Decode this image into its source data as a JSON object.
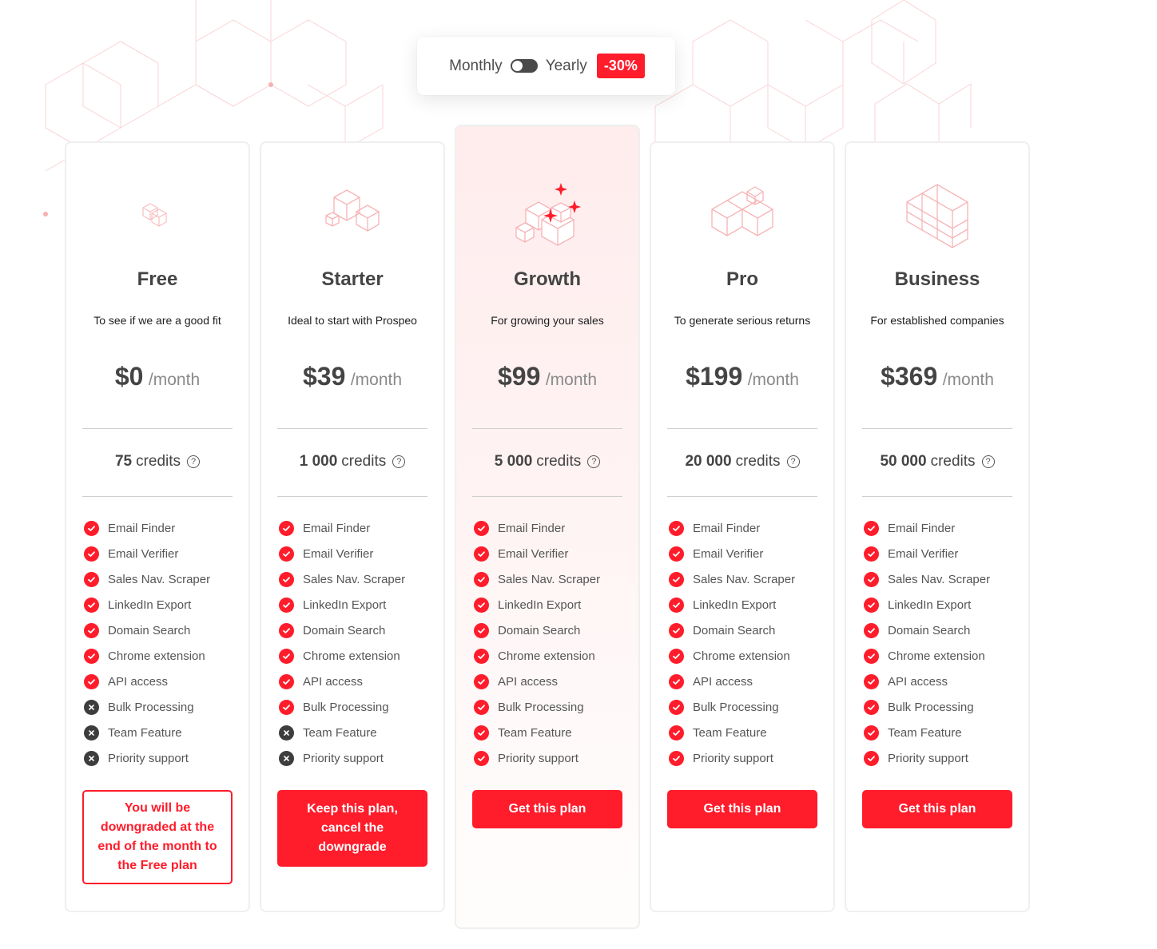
{
  "billing_toggle": {
    "monthly_label": "Monthly",
    "yearly_label": "Yearly",
    "selected": "Monthly",
    "discount_badge": "-30%"
  },
  "colors": {
    "accent": "#ff1c2b",
    "text_dark": "#444444",
    "icon_pink": "#f8b9bb",
    "disabled_icon": "#3d3d3d"
  },
  "plans": [
    {
      "id": "free",
      "name": "Free",
      "tagline": "To see if we are a good fit",
      "price": "$0",
      "period": "/month",
      "credits_amount": "75",
      "credits_label": "credits",
      "icon": "two-cubes-icon",
      "highlighted": false,
      "features": [
        {
          "label": "Email Finder",
          "included": true
        },
        {
          "label": "Email Verifier",
          "included": true
        },
        {
          "label": "Sales Nav. Scraper",
          "included": true
        },
        {
          "label": "LinkedIn Export",
          "included": true
        },
        {
          "label": "Domain Search",
          "included": true
        },
        {
          "label": "Chrome extension",
          "included": true
        },
        {
          "label": "API access",
          "included": true
        },
        {
          "label": "Bulk Processing",
          "included": false
        },
        {
          "label": "Team Feature",
          "included": false
        },
        {
          "label": "Priority support",
          "included": false
        }
      ],
      "cta": {
        "label": "You will be downgraded at the end of the month to the Free plan",
        "style": "outline"
      }
    },
    {
      "id": "starter",
      "name": "Starter",
      "tagline": "Ideal to start with Prospeo",
      "price": "$39",
      "period": "/month",
      "credits_amount": "1 000",
      "credits_label": "credits",
      "icon": "three-cubes-icon",
      "highlighted": false,
      "features": [
        {
          "label": "Email Finder",
          "included": true
        },
        {
          "label": "Email Verifier",
          "included": true
        },
        {
          "label": "Sales Nav. Scraper",
          "included": true
        },
        {
          "label": "LinkedIn Export",
          "included": true
        },
        {
          "label": "Domain Search",
          "included": true
        },
        {
          "label": "Chrome extension",
          "included": true
        },
        {
          "label": "API access",
          "included": true
        },
        {
          "label": "Bulk Processing",
          "included": true
        },
        {
          "label": "Team Feature",
          "included": false
        },
        {
          "label": "Priority support",
          "included": false
        }
      ],
      "cta": {
        "label": "Keep this plan, cancel the downgrade",
        "style": "solid"
      }
    },
    {
      "id": "growth",
      "name": "Growth",
      "tagline": "For growing your sales",
      "price": "$99",
      "period": "/month",
      "credits_amount": "5 000",
      "credits_label": "credits",
      "icon": "sparkle-cubes-icon",
      "highlighted": true,
      "features": [
        {
          "label": "Email Finder",
          "included": true
        },
        {
          "label": "Email Verifier",
          "included": true
        },
        {
          "label": "Sales Nav. Scraper",
          "included": true
        },
        {
          "label": "LinkedIn Export",
          "included": true
        },
        {
          "label": "Domain Search",
          "included": true
        },
        {
          "label": "Chrome extension",
          "included": true
        },
        {
          "label": "API access",
          "included": true
        },
        {
          "label": "Bulk Processing",
          "included": true
        },
        {
          "label": "Team Feature",
          "included": true
        },
        {
          "label": "Priority support",
          "included": true
        }
      ],
      "cta": {
        "label": "Get this plan",
        "style": "solid"
      }
    },
    {
      "id": "pro",
      "name": "Pro",
      "tagline": "To generate serious returns",
      "price": "$199",
      "period": "/month",
      "credits_amount": "20 000",
      "credits_label": "credits",
      "icon": "stacked-cubes-icon",
      "highlighted": false,
      "features": [
        {
          "label": "Email Finder",
          "included": true
        },
        {
          "label": "Email Verifier",
          "included": true
        },
        {
          "label": "Sales Nav. Scraper",
          "included": true
        },
        {
          "label": "LinkedIn Export",
          "included": true
        },
        {
          "label": "Domain Search",
          "included": true
        },
        {
          "label": "Chrome extension",
          "included": true
        },
        {
          "label": "API access",
          "included": true
        },
        {
          "label": "Bulk Processing",
          "included": true
        },
        {
          "label": "Team Feature",
          "included": true
        },
        {
          "label": "Priority support",
          "included": true
        }
      ],
      "cta": {
        "label": "Get this plan",
        "style": "solid"
      }
    },
    {
      "id": "business",
      "name": "Business",
      "tagline": "For established companies",
      "price": "$369",
      "period": "/month",
      "credits_amount": "50 000",
      "credits_label": "credits",
      "icon": "cube-block-icon",
      "highlighted": false,
      "features": [
        {
          "label": "Email Finder",
          "included": true
        },
        {
          "label": "Email Verifier",
          "included": true
        },
        {
          "label": "Sales Nav. Scraper",
          "included": true
        },
        {
          "label": "LinkedIn Export",
          "included": true
        },
        {
          "label": "Domain Search",
          "included": true
        },
        {
          "label": "Chrome extension",
          "included": true
        },
        {
          "label": "API access",
          "included": true
        },
        {
          "label": "Bulk Processing",
          "included": true
        },
        {
          "label": "Team Feature",
          "included": true
        },
        {
          "label": "Priority support",
          "included": true
        }
      ],
      "cta": {
        "label": "Get this plan",
        "style": "solid"
      }
    }
  ]
}
